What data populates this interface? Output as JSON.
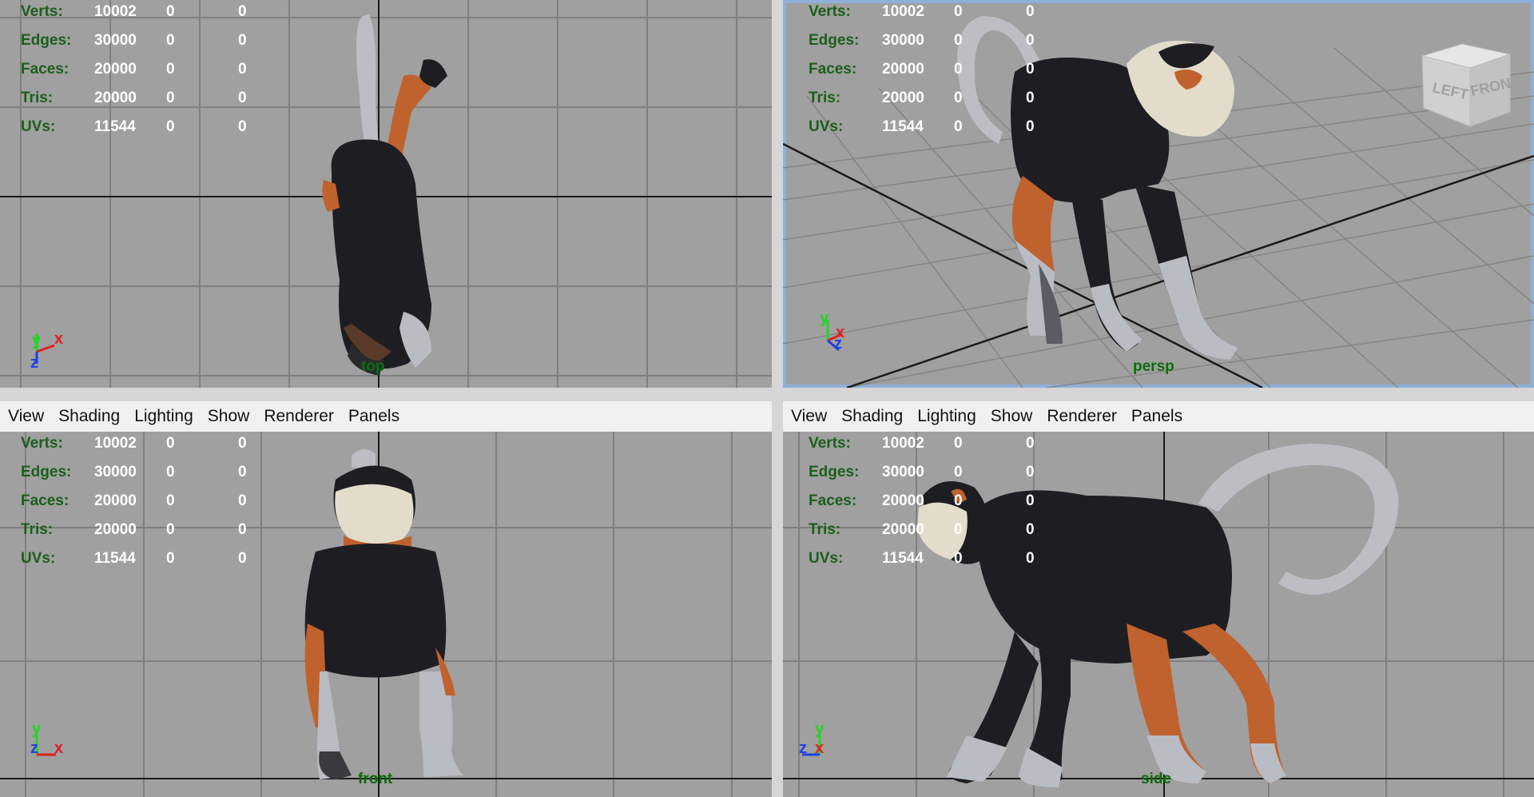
{
  "hud_stats": [
    {
      "label": "Verts:",
      "v1": "10002",
      "v2": "0",
      "v3": "0"
    },
    {
      "label": "Edges:",
      "v1": "30000",
      "v2": "0",
      "v3": "0"
    },
    {
      "label": "Faces:",
      "v1": "20000",
      "v2": "0",
      "v3": "0"
    },
    {
      "label": "Tris:",
      "v1": "20000",
      "v2": "0",
      "v3": "0"
    },
    {
      "label": "UVs:",
      "v1": "11544",
      "v2": "0",
      "v3": "0"
    }
  ],
  "menu": [
    "View",
    "Shading",
    "Lighting",
    "Show",
    "Renderer",
    "Panels"
  ],
  "cameras": {
    "top": "top",
    "persp": "persp",
    "front": "front",
    "side": "side"
  },
  "axes": {
    "x": "x",
    "y": "y",
    "z": "z"
  },
  "view_cube": {
    "left": "LEFT",
    "front": "FRONT"
  },
  "colors": {
    "viewport_bg": "#a0a0a0",
    "hud_label": "#1b5e1b",
    "hud_value": "#ffffff",
    "grid": "#7f7f7f",
    "axis_line": "#1a1a1a",
    "selection": "#8fb0d9",
    "fur": "#1e1e22",
    "orange": "#c0622e",
    "gray_limb": "#b9bcc3"
  }
}
